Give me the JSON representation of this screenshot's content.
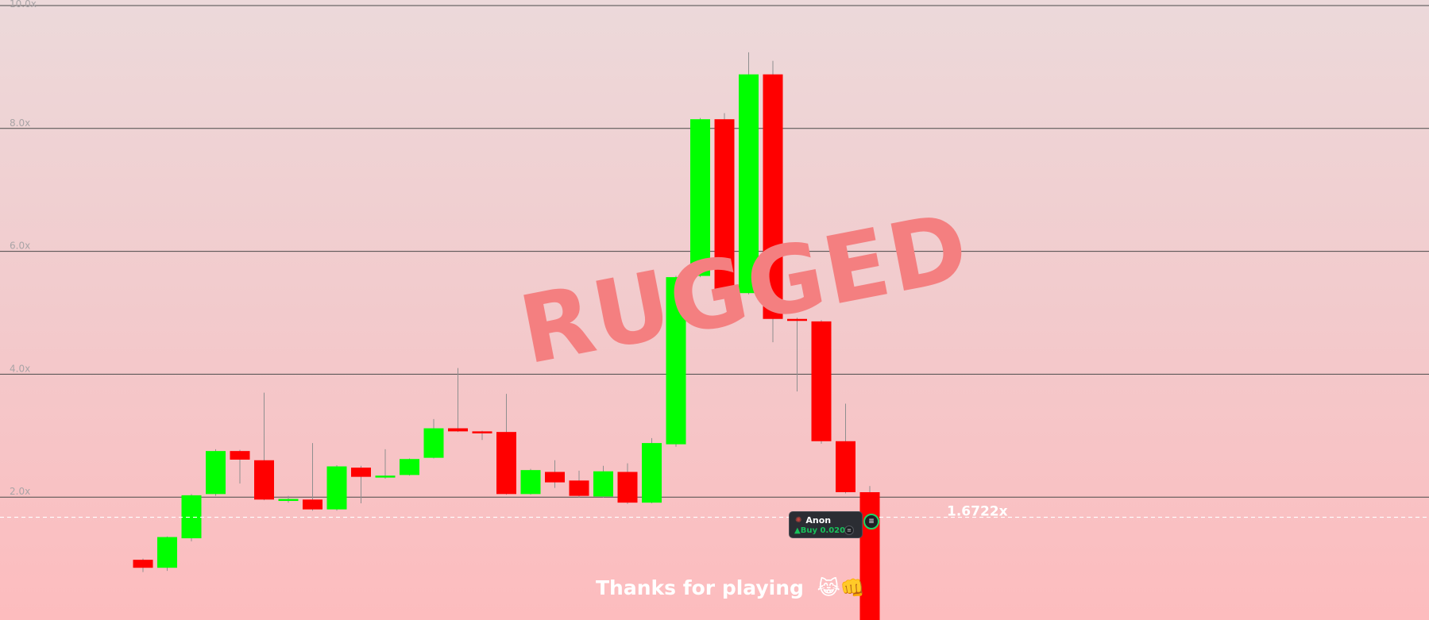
{
  "chart_data": {
    "type": "candlestick",
    "title": "",
    "xlabel": "",
    "ylabel": "",
    "ylim": [
      0,
      10
    ],
    "y_ticks": [
      "2.0x",
      "4.0x",
      "6.0x",
      "8.0x",
      "10.0x"
    ],
    "grid": true,
    "colors": {
      "up": "#00ff00",
      "down": "#ff0000",
      "wick": "#8f8f8f",
      "grid": "#4a4a4a"
    },
    "candles": [
      {
        "open": 0.98,
        "close": 0.85,
        "high": 1.0,
        "low": 0.78
      },
      {
        "open": 0.85,
        "close": 1.35,
        "high": 1.36,
        "low": 0.8
      },
      {
        "open": 1.33,
        "close": 2.03,
        "high": 2.05,
        "low": 1.28
      },
      {
        "open": 2.05,
        "close": 2.75,
        "high": 2.78,
        "low": 2.02
      },
      {
        "open": 2.75,
        "close": 2.61,
        "high": 2.77,
        "low": 2.22
      },
      {
        "open": 2.6,
        "close": 1.96,
        "high": 3.7,
        "low": 1.95
      },
      {
        "open": 1.94,
        "close": 1.97,
        "high": 2.02,
        "low": 1.91
      },
      {
        "open": 1.96,
        "close": 1.8,
        "high": 2.88,
        "low": 1.78
      },
      {
        "open": 1.8,
        "close": 2.5,
        "high": 2.52,
        "low": 1.78
      },
      {
        "open": 2.48,
        "close": 2.33,
        "high": 2.51,
        "low": 1.9
      },
      {
        "open": 2.33,
        "close": 2.35,
        "high": 2.78,
        "low": 2.3
      },
      {
        "open": 2.36,
        "close": 2.62,
        "high": 2.63,
        "low": 2.35
      },
      {
        "open": 2.64,
        "close": 3.12,
        "high": 3.27,
        "low": 2.63
      },
      {
        "open": 3.12,
        "close": 3.07,
        "high": 4.1,
        "low": 3.06
      },
      {
        "open": 3.07,
        "close": 3.06,
        "high": 3.08,
        "low": 2.93
      },
      {
        "open": 3.06,
        "close": 2.05,
        "high": 3.68,
        "low": 2.04
      },
      {
        "open": 2.05,
        "close": 2.44,
        "high": 2.46,
        "low": 2.04
      },
      {
        "open": 2.41,
        "close": 2.24,
        "high": 2.6,
        "low": 2.15
      },
      {
        "open": 2.27,
        "close": 2.02,
        "high": 2.43,
        "low": 1.99
      },
      {
        "open": 2.01,
        "close": 2.42,
        "high": 2.51,
        "low": 1.99
      },
      {
        "open": 2.41,
        "close": 1.91,
        "high": 2.55,
        "low": 1.89
      },
      {
        "open": 1.91,
        "close": 2.88,
        "high": 2.96,
        "low": 1.9
      },
      {
        "open": 2.86,
        "close": 5.58,
        "high": 5.6,
        "low": 2.82
      },
      {
        "open": 5.6,
        "close": 8.15,
        "high": 8.17,
        "low": 5.58
      },
      {
        "open": 8.15,
        "close": 5.34,
        "high": 8.25,
        "low": 5.32
      },
      {
        "open": 5.32,
        "close": 8.88,
        "high": 9.24,
        "low": 5.3
      },
      {
        "open": 8.88,
        "close": 4.9,
        "high": 9.1,
        "low": 4.52
      },
      {
        "open": 4.9,
        "close": 4.87,
        "high": 4.92,
        "low": 3.72
      },
      {
        "open": 4.86,
        "close": 2.91,
        "high": 4.88,
        "low": 2.87
      },
      {
        "open": 2.91,
        "close": 2.08,
        "high": 3.52,
        "low": 2.06
      },
      {
        "open": 2.08,
        "close": 0.0,
        "high": 2.18,
        "low": 0.0
      }
    ],
    "current_price": 1.6722,
    "current_price_label": "1.6722x"
  },
  "overlay": {
    "status_text": "RUGGED",
    "footer_message": "Thanks for playing",
    "footer_emoji": "😹👊"
  },
  "trade": {
    "user_name": "Anon",
    "action_text": "Buy 0.020",
    "icon_glyph": "≡",
    "avatar_icon": "spider-icon"
  }
}
